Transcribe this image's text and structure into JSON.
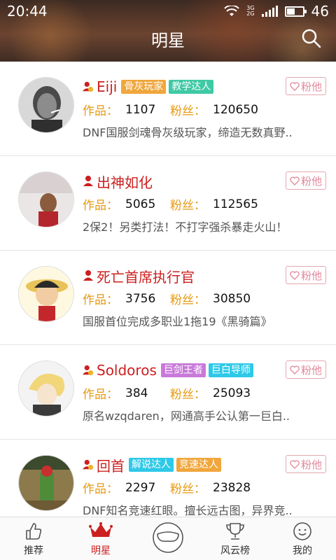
{
  "status": {
    "time": "20:44",
    "battery": "46",
    "network_top": "3G",
    "network_bottom": "2G"
  },
  "header": {
    "title": "明星"
  },
  "list": [
    {
      "name": "Eiji",
      "tags": [
        {
          "text": "骨灰玩家",
          "color": "#f0a63c"
        },
        {
          "text": "教学达人",
          "color": "#3fc9a4"
        }
      ],
      "works_label": "作品：",
      "works": "1107",
      "fans_label": "粉丝：",
      "fans": "120650",
      "desc": "DNF国服剑魂骨灰级玩家，缔造无数真野..",
      "button": "粉他",
      "badge": "medal"
    },
    {
      "name": "出神如化",
      "tags": [],
      "works_label": "作品：",
      "works": "5065",
      "fans_label": "粉丝：",
      "fans": "112565",
      "desc": "2保2！另类打法！不打字强杀暴走火山！",
      "button": "粉他",
      "badge": "plain"
    },
    {
      "name": "死亡首席执行官",
      "tags": [],
      "works_label": "作品：",
      "works": "3756",
      "fans_label": "粉丝：",
      "fans": "30850",
      "desc": "国服首位完成多职业1拖19《黑骑篇》",
      "button": "粉他",
      "badge": "plain"
    },
    {
      "name": "Soldoros",
      "tags": [
        {
          "text": "巨剑王者",
          "color": "#c97ad9"
        },
        {
          "text": "巨白导师",
          "color": "#2ec9e8"
        }
      ],
      "works_label": "作品：",
      "works": "384",
      "fans_label": "粉丝：",
      "fans": "25093",
      "desc": "原名wzqdaren，网通高手公认第一巨白..",
      "button": "粉他",
      "badge": "medal"
    },
    {
      "name": "回首",
      "tags": [
        {
          "text": "解说达人",
          "color": "#2ec9e8"
        },
        {
          "text": "竞速达人",
          "color": "#f0a63c"
        }
      ],
      "works_label": "作品：",
      "works": "2297",
      "fans_label": "粉丝：",
      "fans": "23828",
      "desc": "DNF知名竞速红眼。擅长远古图，异界竞..",
      "button": "粉他",
      "badge": "medal"
    }
  ],
  "nav": [
    {
      "label": "推荐",
      "icon": "thumbs-up-icon"
    },
    {
      "label": "明星",
      "icon": "crown-icon",
      "active": true
    },
    {
      "label": "",
      "icon": "mask-icon"
    },
    {
      "label": "风云榜",
      "icon": "trophy-icon"
    },
    {
      "label": "我的",
      "icon": "smiley-icon"
    }
  ],
  "colors": {
    "accent": "#cc1f1f",
    "stat_label": "#e69a10",
    "follow_border": "#e3a7b0"
  }
}
